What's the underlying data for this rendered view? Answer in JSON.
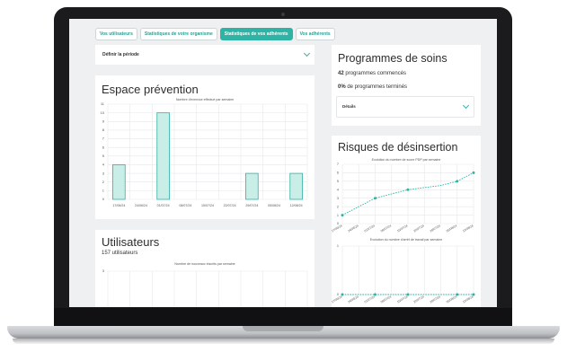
{
  "tabs": [
    {
      "label": "Vos utilisateurs",
      "active": false
    },
    {
      "label": "Statistiques de votre organisme",
      "active": false
    },
    {
      "label": "Statistiques de vos adhérents",
      "active": true
    },
    {
      "label": "Vos adhérents",
      "active": false
    }
  ],
  "period": {
    "label": "Définir la période"
  },
  "prevention": {
    "title": "Espace prévention",
    "chart_title": "Nombre d'exercice effectué par semaine"
  },
  "programmes": {
    "title": "Programmes de soins",
    "started_count": "42",
    "started_text": " programmes commencés",
    "finished_pct": "0%",
    "finished_text": " de programmes terminés",
    "details_label": "Détails"
  },
  "risques": {
    "title": "Risques de désinsertion",
    "chart1_title": "Evolution du nombre de score PDP par semaine",
    "chart2_title": "Evolution du nombre d'arrêt de travail par semaine"
  },
  "utilisateurs": {
    "title": "Utilisateurs",
    "count_text": "157 utilisateurs",
    "chart_title": "Nombre de nouveaux inscrits par semaine"
  },
  "colors": {
    "accent": "#2fb3a5",
    "bar_fill": "#c9eee8",
    "bar_stroke": "#2fb3a5"
  },
  "chart_data": [
    {
      "type": "bar",
      "title": "Nombre d'exercice effectué par semaine",
      "categories": [
        "17/06/24",
        "24/06/24",
        "01/07/24",
        "08/07/24",
        "15/07/24",
        "22/07/24",
        "29/07/24",
        "05/08/24",
        "12/08/24"
      ],
      "values": [
        4,
        0,
        10,
        0,
        0,
        0,
        3,
        0,
        3
      ],
      "ylim": [
        0,
        11
      ],
      "yticks": [
        0,
        1,
        2,
        3,
        4,
        5,
        6,
        7,
        8,
        9,
        10,
        11
      ],
      "grid": true
    },
    {
      "type": "line",
      "title": "Evolution du nombre de score PDP par semaine",
      "categories": [
        "17/06/24",
        "24/06/24",
        "01/07/24",
        "08/07/24",
        "15/07/24",
        "22/07/24",
        "29/07/24",
        "05/08/24",
        "12/08/24"
      ],
      "values": [
        1,
        2,
        3,
        3.5,
        4,
        4.25,
        4.5,
        5,
        6
      ],
      "markers_at": [
        0,
        2,
        4,
        7,
        8
      ],
      "ylim": [
        0,
        7
      ],
      "yticks": [
        0,
        1,
        2,
        3,
        4,
        5,
        6,
        7
      ],
      "grid": true
    },
    {
      "type": "line",
      "title": "Evolution du nombre d'arrêt de travail par semaine",
      "categories": [
        "17/06/24",
        "24/06/24",
        "01/07/24",
        "08/07/24",
        "15/07/24",
        "22/07/24",
        "29/07/24",
        "05/08/24",
        "12/08/24"
      ],
      "values": [
        0,
        0,
        0,
        0,
        0,
        0,
        0,
        0,
        0
      ],
      "markers_at": [
        0,
        2,
        4,
        7,
        8
      ],
      "ylim": [
        0,
        1
      ],
      "yticks": [
        0,
        1
      ],
      "grid": true
    },
    {
      "type": "bar",
      "title": "Nombre de nouveaux inscrits par semaine",
      "categories": [],
      "values": [],
      "ylim": [
        2,
        3
      ],
      "yticks": [
        2,
        3
      ],
      "grid": true
    }
  ]
}
